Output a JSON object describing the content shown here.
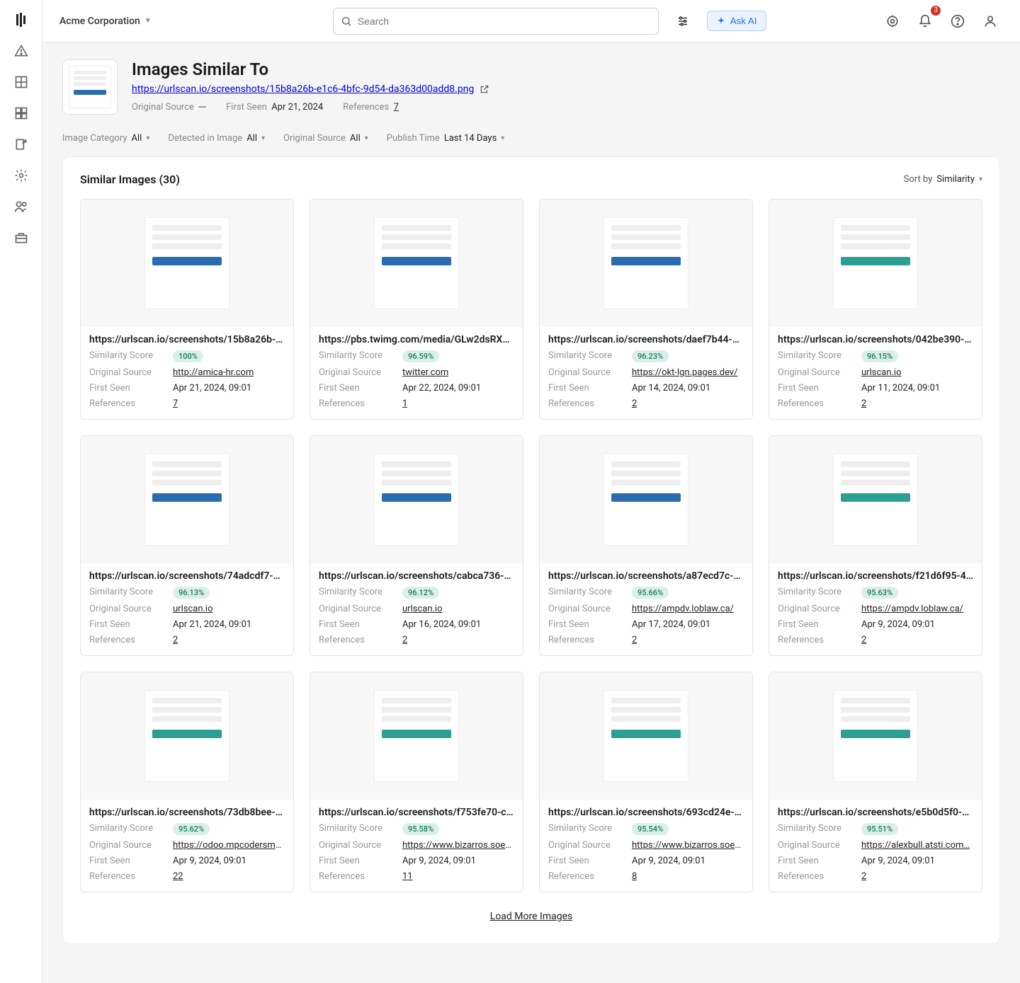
{
  "org": {
    "name": "Acme Corporation"
  },
  "topbar": {
    "search_placeholder": "Search",
    "ask_ai": "Ask AI",
    "notif_count": "3"
  },
  "page": {
    "title": "Images Similar To",
    "source_url": "https://urlscan.io/screenshots/15b8a26b-e1c6-4bfc-9d54-da363d00add8.png",
    "original_source_label": "Original Source",
    "original_source_value": "---",
    "first_seen_label": "First Seen",
    "first_seen_value": "Apr 21, 2024",
    "references_label": "References",
    "references_value": "7"
  },
  "filters": {
    "image_category": {
      "label": "Image Category",
      "value": "All"
    },
    "detected": {
      "label": "Detected in Image",
      "value": "All"
    },
    "original_source": {
      "label": "Original Source",
      "value": "All"
    },
    "publish_time": {
      "label": "Publish Time",
      "value": "Last 14 Days"
    }
  },
  "panel": {
    "title": "Similar Images (30)",
    "sort_label": "Sort by",
    "sort_value": "Similarity",
    "load_more": "Load More Images"
  },
  "labels": {
    "similarity_score": "Similarity Score",
    "original_source": "Original Source",
    "first_seen": "First Seen",
    "references": "References"
  },
  "cards": [
    {
      "url": "https://urlscan.io/screenshots/15b8a26b-…",
      "score": "100%",
      "source": "http://amica-hr.com",
      "first_seen": "Apr 21, 2024, 09:01",
      "refs": "7",
      "style": "blue"
    },
    {
      "url": "https://pbs.twimg.com/media/GLw2dsRXA…",
      "score": "96.59%",
      "source": "twitter.com",
      "first_seen": "Apr 22, 2024, 09:01",
      "refs": "1",
      "style": "blue"
    },
    {
      "url": "https://urlscan.io/screenshots/daef7b44-…",
      "score": "96.23%",
      "source": "https://okt-lgn.pages.dev/",
      "first_seen": "Apr 14, 2024, 09:01",
      "refs": "2",
      "style": "blue"
    },
    {
      "url": "https://urlscan.io/screenshots/042be390-…",
      "score": "96.15%",
      "source": "urlscan.io",
      "first_seen": "Apr 11, 2024, 09:01",
      "refs": "2",
      "style": "teal"
    },
    {
      "url": "https://urlscan.io/screenshots/74adcdf7-a…",
      "score": "96.13%",
      "source": "urlscan.io",
      "first_seen": "Apr 21, 2024, 09:01",
      "refs": "2",
      "style": "blue"
    },
    {
      "url": "https://urlscan.io/screenshots/cabca736-…",
      "score": "96.12%",
      "source": "urlscan.io",
      "first_seen": "Apr 16, 2024, 09:01",
      "refs": "2",
      "style": "blue"
    },
    {
      "url": "https://urlscan.io/screenshots/a87ecd7c-…",
      "score": "95.66%",
      "source": "https://ampdv.loblaw.ca/",
      "first_seen": "Apr 17, 2024, 09:01",
      "refs": "2",
      "style": "blue"
    },
    {
      "url": "https://urlscan.io/screenshots/f21d6f95-4…",
      "score": "95.63%",
      "source": "https://ampdv.loblaw.ca/",
      "first_seen": "Apr 9, 2024, 09:01",
      "refs": "2",
      "style": "teal"
    },
    {
      "url": "https://urlscan.io/screenshots/73db8bee-…",
      "score": "95.62%",
      "source": "https://odoo.mpcodersmx…",
      "first_seen": "Apr 9, 2024, 09:01",
      "refs": "22",
      "style": "teal"
    },
    {
      "url": "https://urlscan.io/screenshots/f753fe70-c…",
      "score": "95.58%",
      "source": "https://www.bizarros.soef…",
      "first_seen": "Apr 9, 2024, 09:01",
      "refs": "11",
      "style": "teal"
    },
    {
      "url": "https://urlscan.io/screenshots/693cd24e-…",
      "score": "95.54%",
      "source": "https://www.bizarros.soef…",
      "first_seen": "Apr 9, 2024, 09:01",
      "refs": "8",
      "style": "teal"
    },
    {
      "url": "https://urlscan.io/screenshots/e5b0d5f0-…",
      "score": "95.51%",
      "source": "https://alexbull.atsti.com…",
      "first_seen": "Apr 9, 2024, 09:01",
      "refs": "2",
      "style": "teal"
    }
  ]
}
